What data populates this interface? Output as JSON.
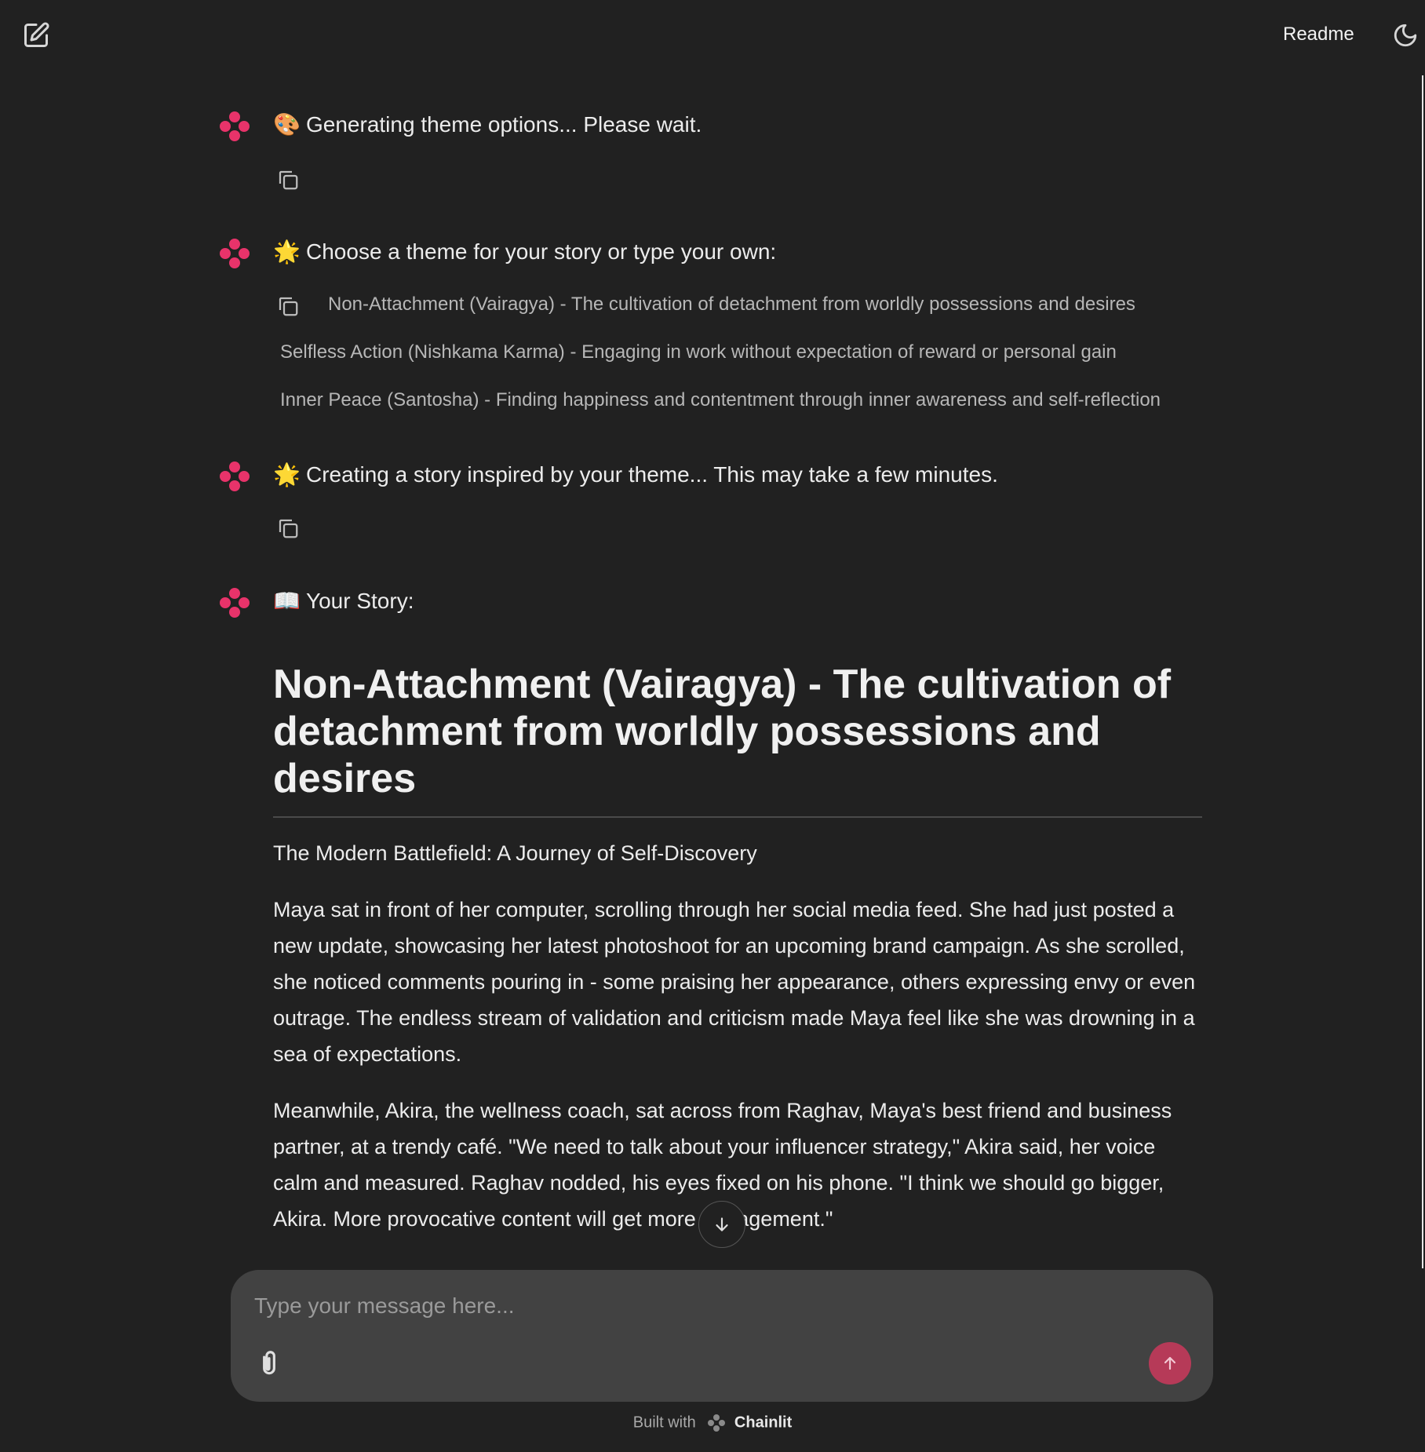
{
  "header": {
    "readme_label": "Readme",
    "new_chat_icon": "edit-icon",
    "theme_icon": "moon-icon"
  },
  "colors": {
    "background": "#212121",
    "accent": "#e8336a",
    "composer": "#424242",
    "send_button": "#b63a58"
  },
  "messages": [
    {
      "emoji": "🎨",
      "text": "Generating theme options... Please wait."
    },
    {
      "emoji": "🌟",
      "text": "Choose a theme for your story or type your own:"
    },
    {
      "emoji": "🌟",
      "text": "Creating a story inspired by your theme... This may take a few minutes."
    },
    {
      "emoji": "📖",
      "text": "Your Story:"
    }
  ],
  "theme_options": [
    "Non-Attachment (Vairagya) - The cultivation of detachment from worldly possessions and desires",
    "Selfless Action (Nishkama Karma) - Engaging in work without expectation of reward or personal gain",
    "Inner Peace (Santosha) - Finding happiness and contentment through inner awareness and self-reflection"
  ],
  "story": {
    "heading": "Non-Attachment (Vairagya) - The cultivation of detachment from worldly possessions and desires",
    "subtitle": "The Modern Battlefield: A Journey of Self-Discovery",
    "paragraphs": [
      "Maya sat in front of her computer, scrolling through her social media feed. She had just posted a new update, showcasing her latest photoshoot for an upcoming brand campaign. As she scrolled, she noticed comments pouring in - some praising her appearance, others expressing envy or even outrage. The endless stream of validation and criticism made Maya feel like she was drowning in a sea of expectations.",
      "Meanwhile, Akira, the wellness coach, sat across from Raghav, Maya's best friend and business partner, at a trendy café. \"We need to talk about your influencer strategy,\" Akira said, her voice calm and measured. Raghav nodded, his eyes fixed on his phone. \"I think we should go bigger, Akira. More provocative content will get more engagement.\""
    ]
  },
  "composer": {
    "placeholder": "Type your message here...",
    "attach_icon": "paperclip-icon",
    "send_icon": "arrow-up-icon"
  },
  "footer": {
    "built_with": "Built with",
    "brand": "Chainlit"
  }
}
